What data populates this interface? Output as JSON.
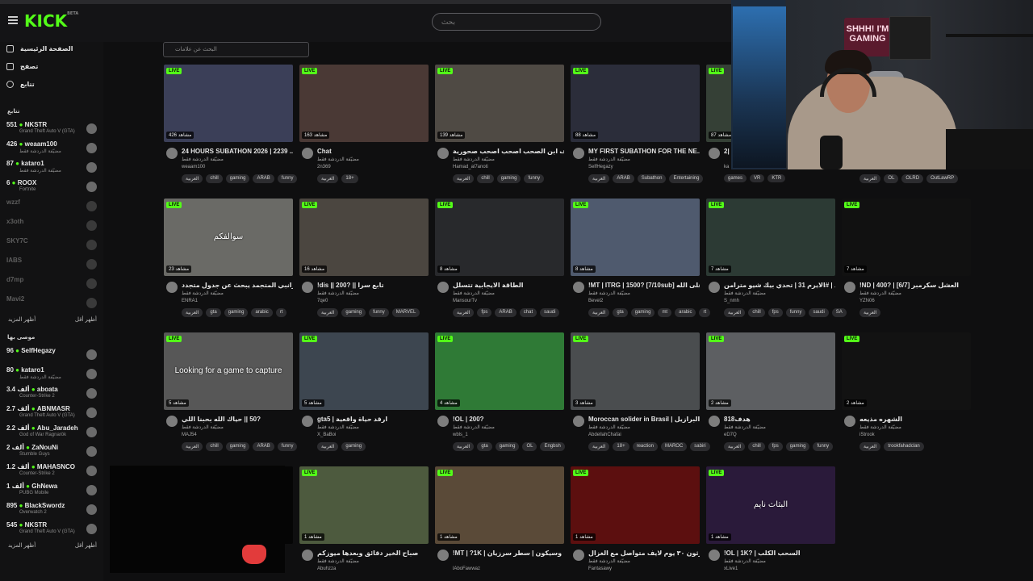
{
  "header": {
    "logo": "KICK",
    "logo_badge": "BETA",
    "search_placeholder": "بحث"
  },
  "sidebar": {
    "nav": [
      "الصفحة الرئيسية",
      "تصفح",
      "تتابع"
    ],
    "following_title": "تتابع",
    "following": [
      {
        "viewers": "551",
        "name": "NKSTR",
        "sub": "Grand Theft Auto V (GTA)",
        "online": true
      },
      {
        "viewers": "426",
        "name": "weaam100",
        "sub": "مضيّفة الدردشة فقط",
        "online": true
      },
      {
        "viewers": "87",
        "name": "kataro1",
        "sub": "مضيّفة الدردشة فقط",
        "online": true
      },
      {
        "viewers": "6",
        "name": "ROOX",
        "sub": "Fortnite",
        "online": true
      },
      {
        "viewers": "",
        "name": "wzzf",
        "sub": "",
        "online": false
      },
      {
        "viewers": "",
        "name": "x3oth",
        "sub": "",
        "online": false
      },
      {
        "viewers": "",
        "name": "SKY7C",
        "sub": "",
        "online": false
      },
      {
        "viewers": "",
        "name": "IABS",
        "sub": "",
        "online": false
      },
      {
        "viewers": "",
        "name": "d7mp",
        "sub": "",
        "online": false
      },
      {
        "viewers": "",
        "name": "Mavi2",
        "sub": "",
        "online": false
      }
    ],
    "show_more": "أظهر المزيد",
    "show_less": "أظهر أقل",
    "recommended_title": "موصى بها",
    "recommended": [
      {
        "viewers": "96",
        "name": "SelfHegazy",
        "sub": ""
      },
      {
        "viewers": "80",
        "name": "kataro1",
        "sub": "مضيّفة الدردشة فقط"
      },
      {
        "viewers": "3.4 ألف",
        "name": "aboata",
        "sub": "Counter-Strike 2"
      },
      {
        "viewers": "2.7 ألف",
        "name": "ABNMASR",
        "sub": "Grand Theft Auto V (GTA)"
      },
      {
        "viewers": "2.2 ألف",
        "name": "Abu_Jaradeh",
        "sub": "God of War Ragnarök"
      },
      {
        "viewers": "2 ألف",
        "name": "ZaNouNi",
        "sub": "Stumble Guys"
      },
      {
        "viewers": "1.2 ألف",
        "name": "MAHASNCO",
        "sub": "Counter-Strike 2"
      },
      {
        "viewers": "1 ألف",
        "name": "GhNewa",
        "sub": "PUBG Mobile"
      },
      {
        "viewers": "895",
        "name": "BlackSwordz",
        "sub": "Overwatch 2"
      },
      {
        "viewers": "545",
        "name": "NKSTR",
        "sub": "Grand Theft Auto V (GTA)"
      }
    ]
  },
  "filter_placeholder": "البحث عن علامات",
  "live_label": "LIVE",
  "cards": [
    {
      "viewers": "426 مشاهد",
      "title": "24 HOURS SUBATHON 2026 | 2239 ...",
      "user": "مضيّفة الدردشة فقط",
      "channel": "weaam100",
      "tags": [
        "العربية",
        "chill",
        "gaming",
        "ARAB",
        "funny"
      ],
      "color": "#3b3f58"
    },
    {
      "viewers": "163 مشاهد",
      "title": "Chat",
      "user": "مضيّفة الدردشة فقط",
      "channel": "2n369",
      "tags": [
        "العربية",
        "18+"
      ],
      "color": "#4a3935"
    },
    {
      "viewers": "139 مشاهد",
      "title": "تا لاسات اراف ابن الصحب اصحب اصحب صحورية",
      "user": "مضيّفة الدردشة فقط",
      "channel": "Hamad_al7anoti",
      "tags": [
        "العربية",
        "chill",
        "gaming",
        "funny"
      ],
      "color": "#4f4a44"
    },
    {
      "viewers": "88 مشاهد",
      "title": "MY FIRST SUBATHON FOR THE NE...",
      "user": "مضيّفة الدردشة فقط",
      "channel": "SelfHegazy",
      "tags": [
        "العربية",
        "ARAB",
        "Subathon",
        "Entertaining"
      ],
      "color": "#2b2d3a"
    },
    {
      "viewers": "87 مشاهد",
      "title": "2|",
      "user": "",
      "channel": "ka",
      "tags": [
        "games",
        "VR",
        "KTR"
      ],
      "color": "#354036"
    },
    {
      "viewers": "",
      "title": "",
      "user": "",
      "channel": "",
      "tags": [
        "العربية",
        "OL",
        "OLRD",
        "OutLawRP"
      ],
      "color": "#1a1a1a"
    },
    {
      "viewers": "23 مشاهد",
      "title": "الاكرانبي المتجمد يبحث عن جدول متجدد",
      "user": "مضيّفة الدردشة فقط",
      "channel": "ENRA1",
      "tags": [
        "العربية",
        "gta",
        "gaming",
        "arabic",
        "rt"
      ],
      "color": "#6a6a66",
      "overlay": "سوالفكم"
    },
    {
      "viewers": "16 مشاهد",
      "title": "!dis || 200? || تابع سرا",
      "user": "مضيّفة الدردشة فقط",
      "channel": "7qe0",
      "tags": [
        "العربية",
        "gaming",
        "funny",
        "MARVEL"
      ],
      "color": "#4b4640"
    },
    {
      "viewers": "8 مشاهد",
      "title": "الطاقة الايجابية تتسلل",
      "user": "مضيّفة الدردشة فقط",
      "channel": "MansourTv",
      "tags": [
        "العربية",
        "fps",
        "ARAB",
        "chat",
        "saudi"
      ],
      "color": "#28292c"
    },
    {
      "viewers": "8 مشاهد",
      "title": "!MT | ITRG | 1500? [7/10sub] خليها على الله",
      "user": "مضيّفة الدردشة فقط",
      "channel": "Bevel2",
      "tags": [
        "العربية",
        "gta",
        "gaming",
        "mt",
        "arabic",
        "rt"
      ],
      "color": "#4f5a6e"
    },
    {
      "viewers": "7 مشاهد",
      "title": "الجلد | #الايرم 31 | تحدي بيك شيو مترامن",
      "user": "مضيّفة الدردشة فقط",
      "channel": "S_nmh",
      "tags": [
        "العربية",
        "chill",
        "fps",
        "funny",
        "saudi",
        "SA"
      ],
      "color": "#2c3a34"
    },
    {
      "viewers": "7 مشاهد",
      "title": "!ND | 400? | [6/7] العشل سكرمبر",
      "user": "مضيّفة الدردشة فقط",
      "channel": "YZN06",
      "tags": [
        "العربية"
      ],
      "color": "#111111"
    },
    {
      "viewers": "5 مشاهد",
      "title": "حياك الله بحبنا اللي || ‎50?‎",
      "user": "مضيّفة الدردشة فقط",
      "channel": "MAJ54",
      "tags": [
        "العربية",
        "chill",
        "gaming",
        "ARAB",
        "funny"
      ],
      "color": "#575757",
      "overlay": "Looking for a game to capture"
    },
    {
      "viewers": "5 مشاهد",
      "title": "gta5 | ارقد حياة واقعية",
      "user": "مضيّفة الدردشة فقط",
      "channel": "X_BaBoi",
      "tags": [
        "العربية",
        "gaming"
      ],
      "color": "#3d4650"
    },
    {
      "viewers": "4 مشاهد",
      "title": "!OL | 200?",
      "user": "مضيّفة الدردشة فقط",
      "channel": "wbls_1",
      "tags": [
        "العربية",
        "gta",
        "gaming",
        "OL",
        "Engbsh"
      ],
      "color": "#2f7a36"
    },
    {
      "viewers": "3 مشاهد",
      "title": "Moroccan solider in Brasil | بي البرازيل",
      "user": "مضيّفة الدردشة فقط",
      "channel": "AbdellahChafai",
      "tags": [
        "العربية",
        "18+",
        "reaction",
        "MAROC",
        "sabiri"
      ],
      "color": "#4a4d4f"
    },
    {
      "viewers": "2 مشاهد",
      "title": "هدف818",
      "user": "مضيّفة الدردشة فقط",
      "channel": "eD7Q",
      "tags": [
        "العربية",
        "chill",
        "fps",
        "gaming",
        "funny"
      ],
      "color": "#5d5f62"
    },
    {
      "viewers": "2 مشاهد",
      "title": "الشهره مذيعه",
      "user": "مضيّفة الدردشة فقط",
      "channel": "iStrook",
      "tags": [
        "العربية",
        "trookfahadclan"
      ],
      "color": "#121212"
    },
    {
      "viewers": "",
      "title": "",
      "user": "",
      "channel": "",
      "tags": [],
      "color": "#050505"
    },
    {
      "viewers": "1 مشاهد",
      "title": "صباح الخير دقائق وبعدها ميوزكم",
      "user": "مضيّفة الدردشة فقط",
      "channel": "Abuhzza",
      "tags": [],
      "color": "#4d5a3e"
    },
    {
      "viewers": "1 مشاهد",
      "title": "!MT | ?1K | اخوك وسيكون | سطر سرزيان",
      "user": "",
      "channel": "lAboFawwaz",
      "tags": [],
      "color": "#5a4a38"
    },
    {
      "viewers": "1 مشاهد",
      "title": "مارثون ٣٠ يوم لايف متواصل مع الغزال",
      "user": "مضيّفة الدردشة فقط",
      "channel": "Fantasawy",
      "tags": [],
      "color": "#5c0f0f"
    },
    {
      "viewers": "1 مشاهد",
      "title": "!OL | 1K? | السحب الكلب",
      "user": "مضيّفة الدردشة فقط",
      "channel": "xLive1",
      "tags": [],
      "color": "#2a1a3a",
      "overlay": "البثاث نايم"
    }
  ],
  "webcam": {
    "sign": "SHHH! I'M GAMING"
  }
}
